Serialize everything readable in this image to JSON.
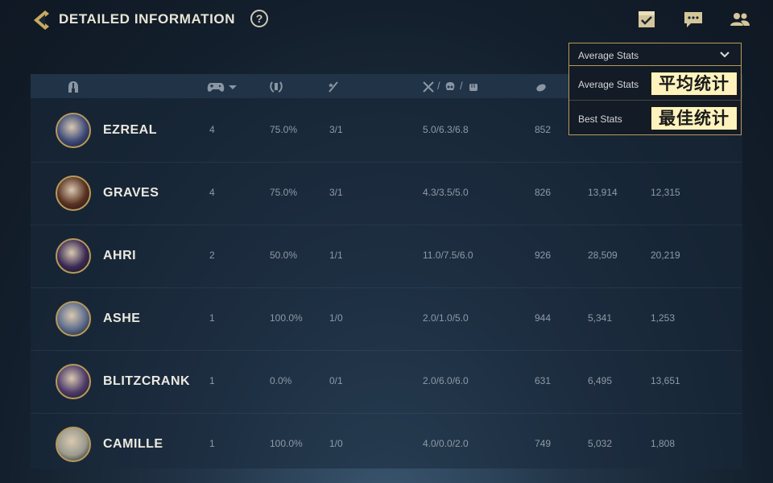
{
  "header": {
    "title": "DETAILED INFORMATION",
    "help_label": "?"
  },
  "header_icons": [
    "checklist-icon",
    "chat-icon",
    "friends-icon"
  ],
  "table": {
    "columns": [
      {
        "id": "champion",
        "icon": "helmet-icon"
      },
      {
        "id": "games",
        "icon": "gamepad-icon",
        "sortable": true
      },
      {
        "id": "winrate",
        "icon": "trophy-laurel-icon"
      },
      {
        "id": "mvp",
        "icon": "sword-star-icon"
      },
      {
        "id": "kda",
        "icons": [
          "crossed-swords-icon",
          "skull-icon",
          "fist-icon"
        ],
        "sep": "/"
      },
      {
        "id": "cs",
        "icon": "minion-icon"
      },
      {
        "id": "damage_dealt"
      },
      {
        "id": "damage_taken"
      }
    ],
    "rows": [
      {
        "name": "EZREAL",
        "games": "4",
        "winrate": "75.0%",
        "mvp": "3/1",
        "kda": "5.0/6.3/6.8",
        "cs": "852",
        "dmg": "",
        "taken": "",
        "avatar_color": "#3d4a7a"
      },
      {
        "name": "GRAVES",
        "games": "4",
        "winrate": "75.0%",
        "mvp": "3/1",
        "kda": "4.3/3.5/5.0",
        "cs": "826",
        "dmg": "13,914",
        "taken": "12,315",
        "avatar_color": "#5a3222"
      },
      {
        "name": "AHRI",
        "games": "2",
        "winrate": "50.0%",
        "mvp": "1/1",
        "kda": "11.0/7.5/6.0",
        "cs": "926",
        "dmg": "28,509",
        "taken": "20,219",
        "avatar_color": "#3a2a55"
      },
      {
        "name": "ASHE",
        "games": "1",
        "winrate": "100.0%",
        "mvp": "1/0",
        "kda": "2.0/1.0/5.0",
        "cs": "944",
        "dmg": "5,341",
        "taken": "1,253",
        "avatar_color": "#5c6c8c"
      },
      {
        "name": "BLITZCRANK",
        "games": "1",
        "winrate": "0.0%",
        "mvp": "0/1",
        "kda": "2.0/6.0/6.0",
        "cs": "631",
        "dmg": "6,495",
        "taken": "13,651",
        "avatar_color": "#4d3b6a"
      },
      {
        "name": "CAMILLE",
        "games": "1",
        "winrate": "100.0%",
        "mvp": "1/0",
        "kda": "4.0/0.0/2.0",
        "cs": "749",
        "dmg": "5,032",
        "taken": "1,808",
        "avatar_color": "#9a9a8e"
      }
    ]
  },
  "stats_dropdown": {
    "selected": "Average Stats",
    "options": [
      {
        "label": "Average Stats",
        "translation": "平均统计"
      },
      {
        "label": "Best Stats",
        "translation": "最佳统计"
      }
    ]
  },
  "colors": {
    "accent_gold": "#b89a5b",
    "text_light": "#ece9e0",
    "text_muted": "#8f9aa6",
    "tag_bg": "#fff3bd"
  }
}
